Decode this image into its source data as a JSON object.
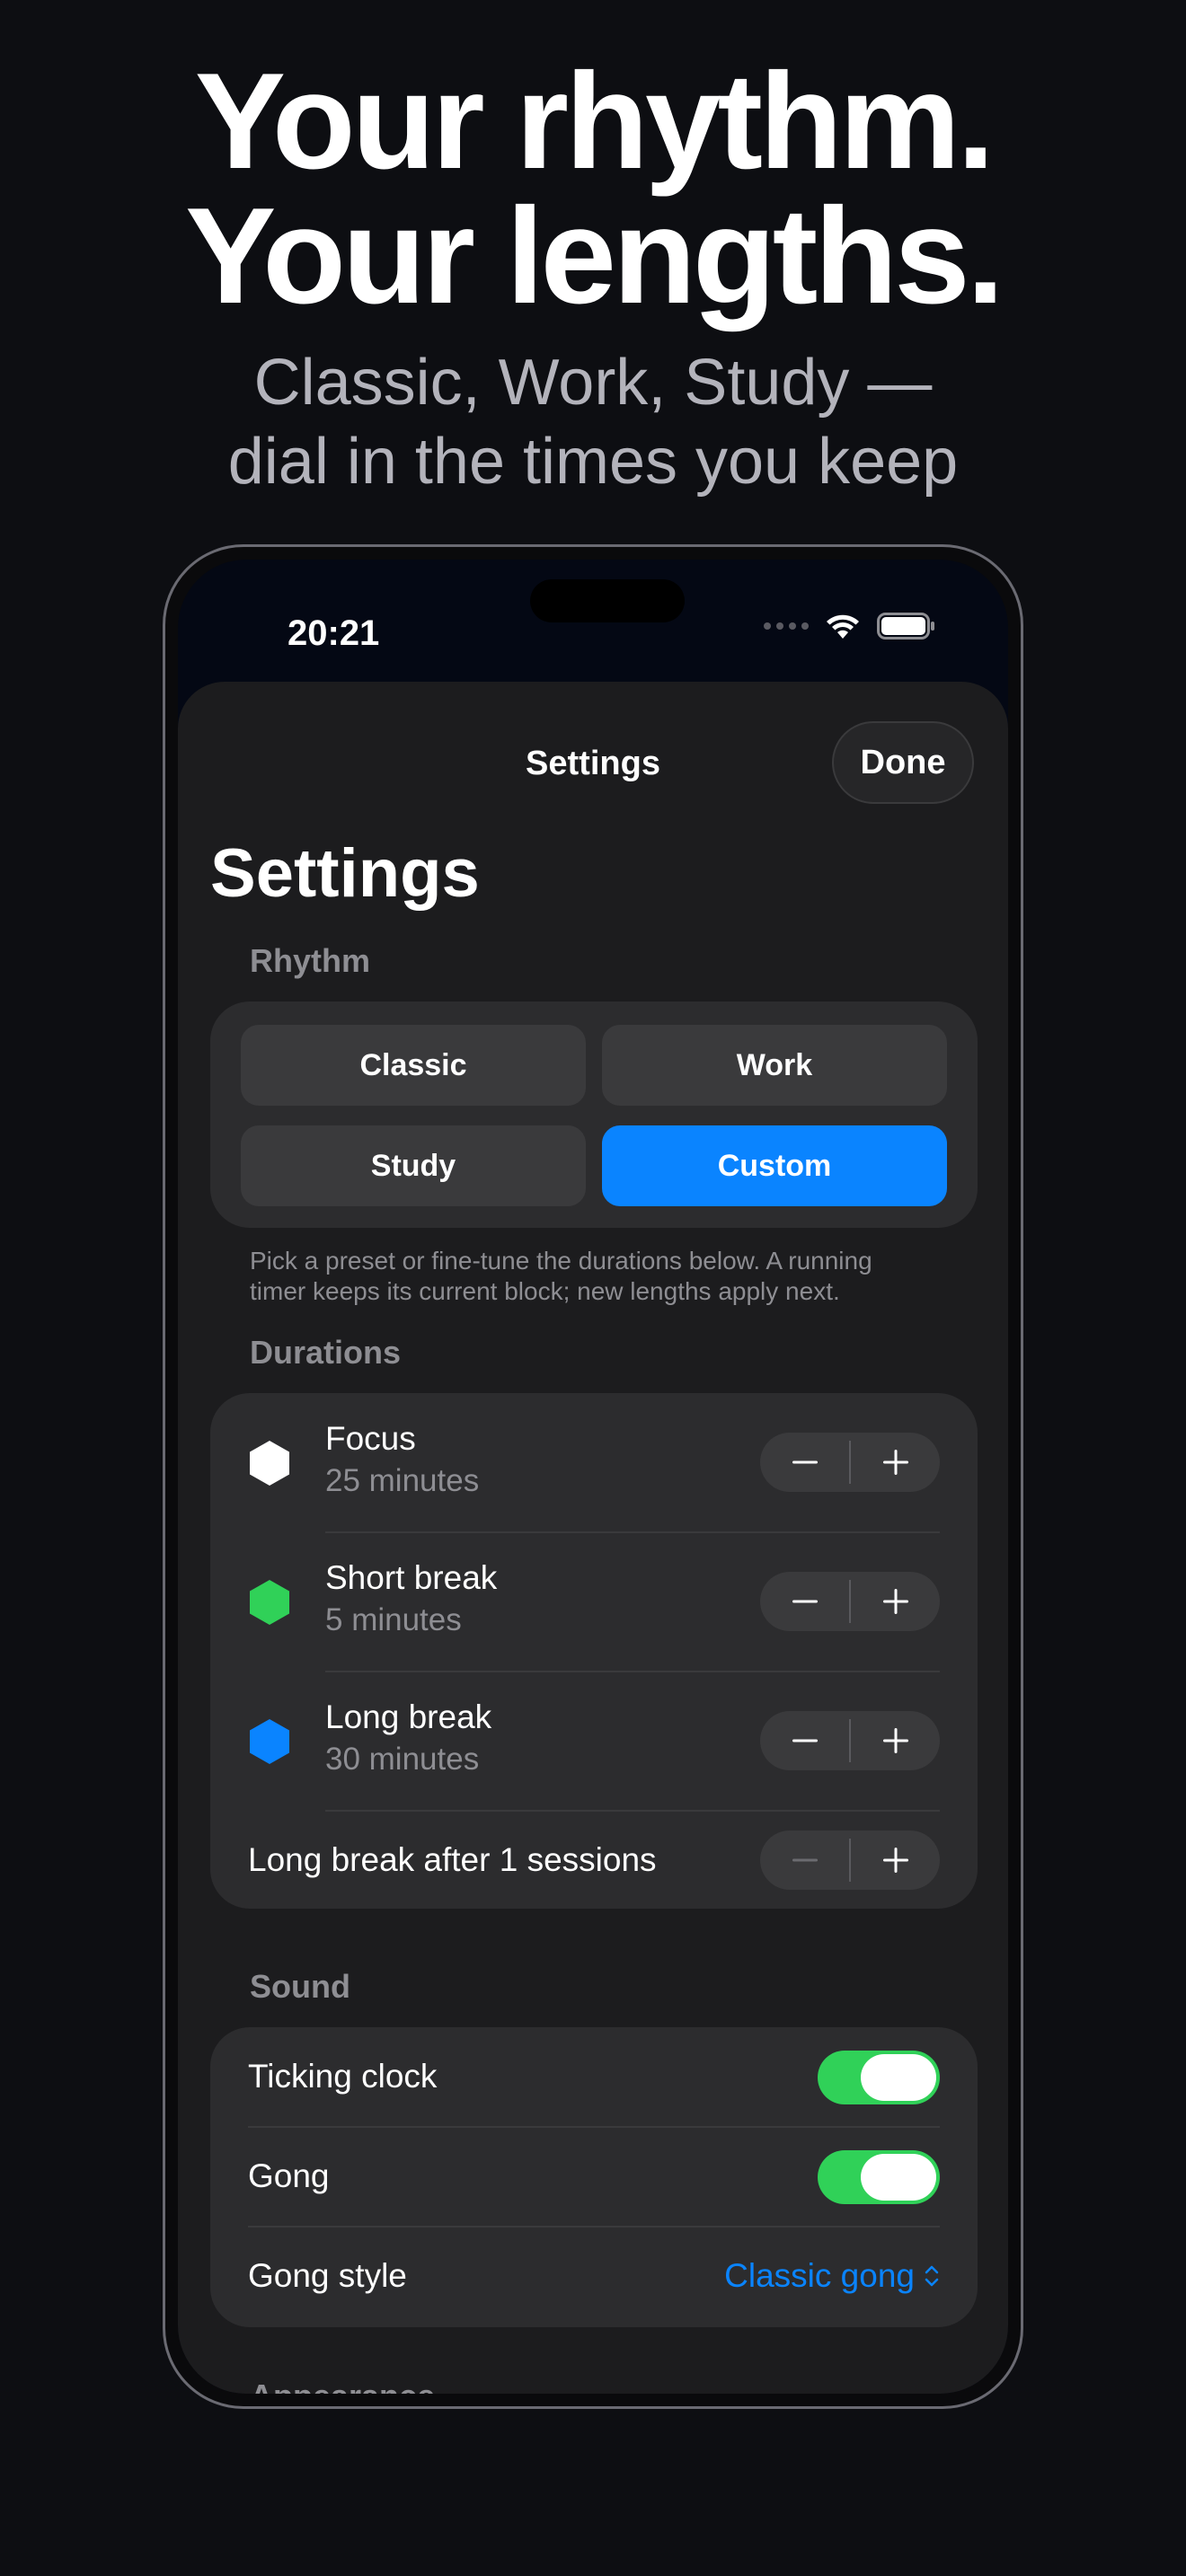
{
  "hero": {
    "headline_line1": "Your rhythm.",
    "headline_line2": "Your lengths.",
    "subhead_line1": "Classic, Work, Study —",
    "subhead_line2": "dial in the times you keep"
  },
  "status_bar": {
    "time": "20:21"
  },
  "sheet": {
    "nav_title": "Settings",
    "done_label": "Done",
    "large_title": "Settings"
  },
  "rhythm": {
    "label": "Rhythm",
    "presets": [
      {
        "label": "Classic",
        "selected": false
      },
      {
        "label": "Work",
        "selected": false
      },
      {
        "label": "Study",
        "selected": false
      },
      {
        "label": "Custom",
        "selected": true
      }
    ],
    "footnote": "Pick a preset or fine-tune the durations below. A running timer keeps its current block; new lengths apply next."
  },
  "durations": {
    "label": "Durations",
    "items": [
      {
        "title": "Focus",
        "value": "25 minutes",
        "color": "#ffffff"
      },
      {
        "title": "Short break",
        "value": "5 minutes",
        "color": "#30d158"
      },
      {
        "title": "Long break",
        "value": "30 minutes",
        "color": "#0a84ff"
      }
    ],
    "long_break_after": "Long break after 1 sessions"
  },
  "sound": {
    "label": "Sound",
    "ticking_label": "Ticking clock",
    "ticking_on": true,
    "gong_label": "Gong",
    "gong_on": true,
    "gong_style_label": "Gong style",
    "gong_style_value": "Classic gong"
  },
  "appearance": {
    "label": "Appearance"
  },
  "colors": {
    "accent": "#0a84ff",
    "toggle_on": "#30d158",
    "card": "#2c2c2e",
    "sheet": "#1c1c1e"
  }
}
